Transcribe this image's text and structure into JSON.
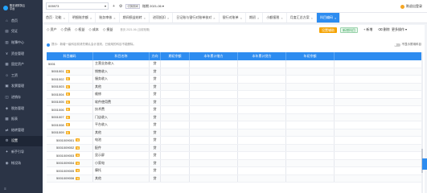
{
  "brand": {
    "title_line1": "账无忧财务云",
    "title_line2": "平台",
    "accent": "#2d8cf0"
  },
  "sidebar": {
    "items": [
      {
        "label": "首页",
        "icon": "home-icon",
        "glyph": "⌂"
      },
      {
        "label": "凭证",
        "icon": "voucher-icon",
        "glyph": "▤"
      },
      {
        "label": "账簿中心",
        "icon": "book-icon",
        "glyph": "▥"
      },
      {
        "label": "资金管理",
        "icon": "money-icon",
        "glyph": "¥"
      },
      {
        "label": "固定资产",
        "icon": "asset-icon",
        "glyph": "▦"
      },
      {
        "label": "工资",
        "icon": "salary-icon",
        "glyph": "☺"
      },
      {
        "label": "发票管理",
        "icon": "invoice-icon",
        "glyph": "▣"
      },
      {
        "label": "进销存",
        "icon": "inventory-icon",
        "glyph": "◫"
      },
      {
        "label": "税务管理",
        "icon": "tax-icon",
        "glyph": "◈"
      },
      {
        "label": "报表",
        "icon": "report-icon",
        "glyph": "▩"
      },
      {
        "label": "结转管理",
        "icon": "transfer-icon",
        "glyph": "⇄"
      },
      {
        "label": "设置",
        "icon": "settings-icon",
        "glyph": "⚙",
        "active": true
      },
      {
        "label": "新手引导",
        "icon": "guide-icon",
        "glyph": "✦"
      },
      {
        "label": "帐设场",
        "icon": "account-icon",
        "glyph": "◉"
      }
    ],
    "collapse": "≡"
  },
  "topbar": {
    "company": "005973",
    "switch_label": "切换期间",
    "period_label": "账期",
    "period": "2021-06",
    "user": "陈",
    "exit": "退出登录"
  },
  "tabs": [
    {
      "label": "首页 · 功能",
      "active": false
    },
    {
      "label": "明细账余额",
      "active": false
    },
    {
      "label": "账务审核",
      "active": false
    },
    {
      "label": "期间损益结转",
      "active": false
    },
    {
      "label": "进项抵扣",
      "active": false
    },
    {
      "label": "日记账与银行对账单核对",
      "active": false
    },
    {
      "label": "银行对账单",
      "active": false
    },
    {
      "label": "期初",
      "active": false
    },
    {
      "label": "小额报税",
      "active": false
    },
    {
      "label": "月度汇总方案",
      "active": false
    },
    {
      "label": "科目编码",
      "active": true
    }
  ],
  "toolbar": {
    "buttons": [
      {
        "label": "资产",
        "icon": "asset-icon",
        "glyph": "◇"
      },
      {
        "label": "负债",
        "icon": "liability-icon",
        "glyph": "◇"
      },
      {
        "label": "权益",
        "icon": "equity-icon",
        "glyph": "◇"
      },
      {
        "label": "成本",
        "icon": "cost-icon",
        "glyph": "◇"
      },
      {
        "label": "损益",
        "icon": "profit-icon",
        "glyph": "◇"
      }
    ],
    "first_hint": "首页 2021-06 (当前账期)",
    "share": "设置辅助",
    "add_account": "新增科目",
    "new": "新增",
    "delete": "删除",
    "more": "更多操作",
    "notice": "提示：新增一级科目前请先确认会计准则，已使用的科目不能删除。",
    "toggle_label": "不显示禁用科目"
  },
  "table": {
    "headers": [
      "科目编码",
      "科目名称",
      "方向",
      "期初余额",
      "本年累计借方",
      "本年累计贷方",
      "年初余额",
      ""
    ],
    "rows": [
      [
        "5001",
        "主营业务收入",
        "贷",
        "",
        "",
        "",
        "",
        ""
      ],
      [
        "5001001",
        "销售收入",
        "贷",
        "",
        "",
        "",
        "",
        ""
      ],
      [
        "5001002",
        "服务收入",
        "贷",
        "",
        "",
        "",
        "",
        ""
      ],
      [
        "5001003",
        "其他",
        "贷",
        "",
        "",
        "",
        "",
        ""
      ],
      [
        "5001004",
        "维修",
        "贷",
        "",
        "",
        "",
        "",
        ""
      ],
      [
        "5001005",
        "软件使用费",
        "贷",
        "",
        "",
        "",
        "",
        ""
      ],
      [
        "5001006",
        "技术费",
        "贷",
        "",
        "",
        "",
        "",
        ""
      ],
      [
        "5001007",
        "门店收入",
        "贷",
        "",
        "",
        "",
        "",
        ""
      ],
      [
        "5001008",
        "平台收入",
        "贷",
        "",
        "",
        "",
        "",
        ""
      ],
      [
        "5001009",
        "其他",
        "贷",
        "",
        "",
        "",
        "",
        ""
      ],
      [
        "5001009001",
        "电池",
        "贷",
        "",
        "",
        "",
        "",
        ""
      ],
      [
        "5001009002",
        "配件",
        "贷",
        "",
        "",
        "",
        "",
        ""
      ],
      [
        "5001009003",
        "显示屏",
        "贷",
        "",
        "",
        "",
        "",
        ""
      ],
      [
        "5001009004",
        "小家电",
        "贷",
        "",
        "",
        "",
        "",
        ""
      ],
      [
        "5001009005",
        "摩托",
        "贷",
        "",
        "",
        "",
        "",
        ""
      ],
      [
        "5001009006",
        "其他",
        "贷",
        "",
        "",
        "",
        "",
        ""
      ]
    ]
  }
}
